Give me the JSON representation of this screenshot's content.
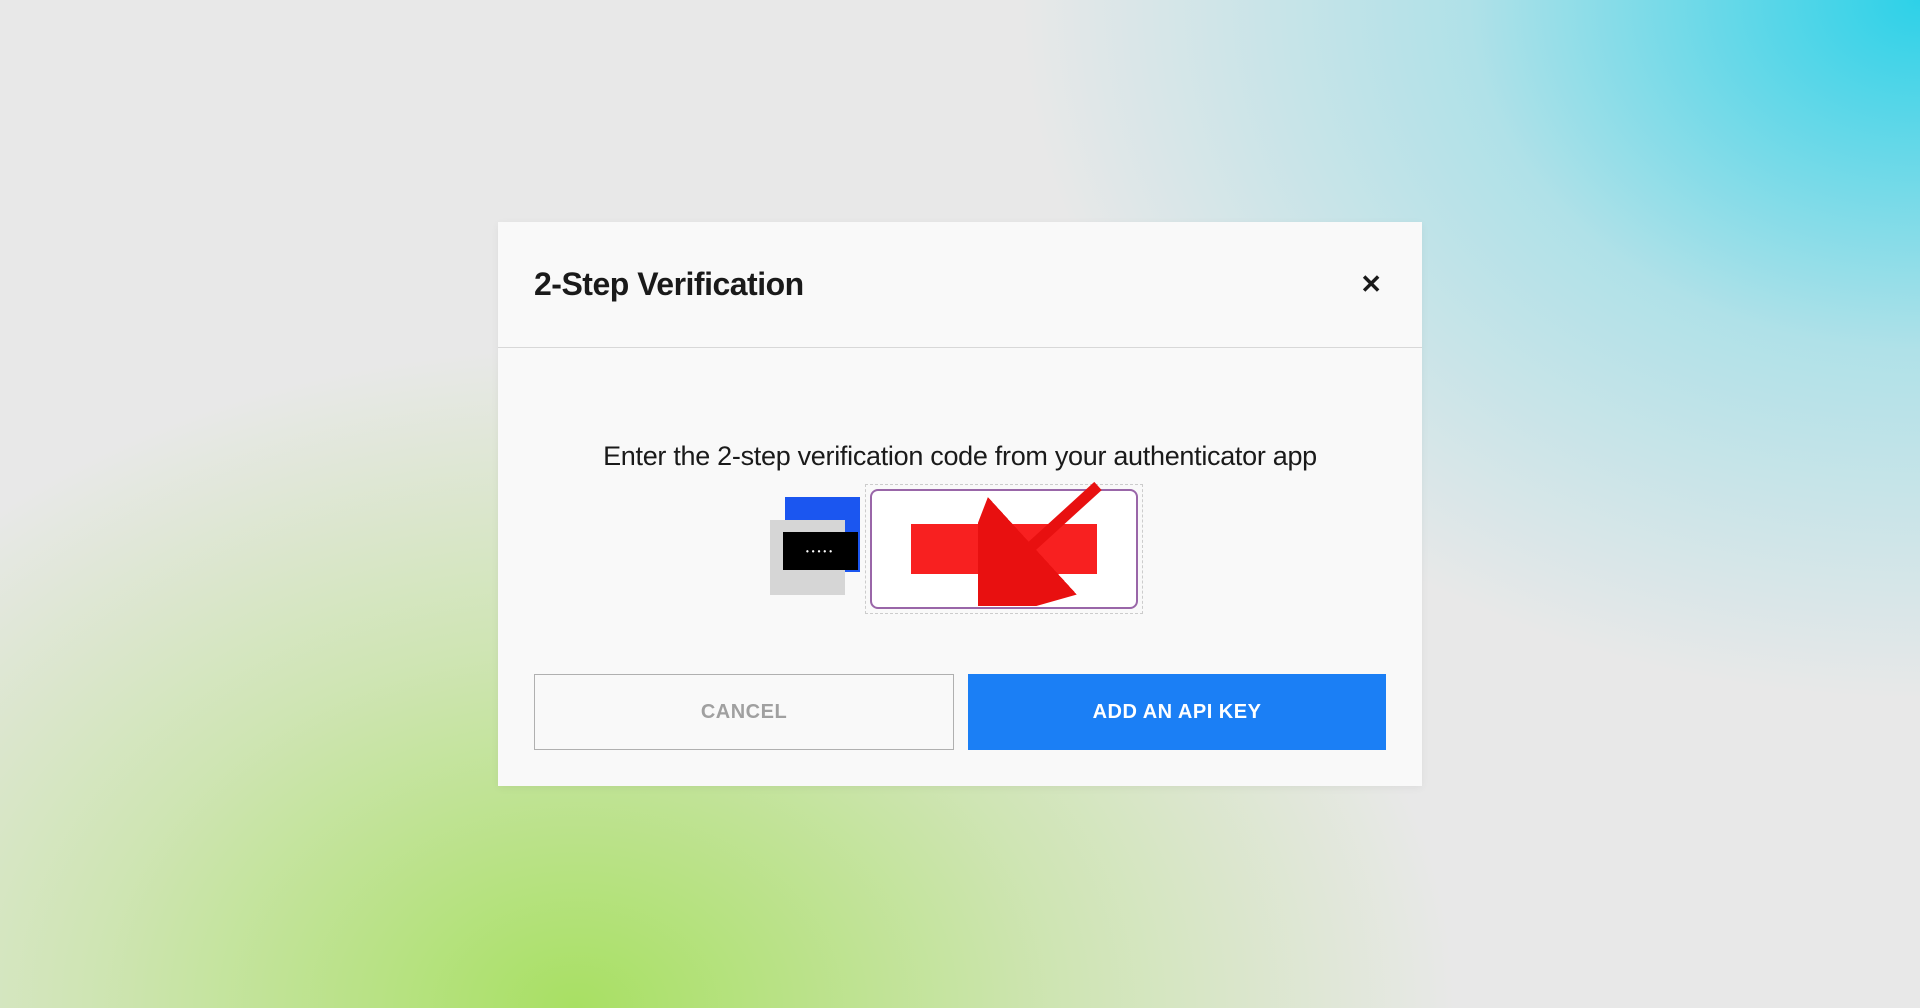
{
  "dialog": {
    "title": "2-Step Verification",
    "instruction": "Enter the 2-step verification code from your authenticator app",
    "cancel_label": "CANCEL",
    "confirm_label": "ADD AN API KEY",
    "close_label": "✕",
    "dots": "•••••"
  },
  "colors": {
    "primary_button": "#1b7ff5",
    "accent_blue": "#1b56f0",
    "redaction": "#f82020",
    "input_border": "#9966a8"
  }
}
